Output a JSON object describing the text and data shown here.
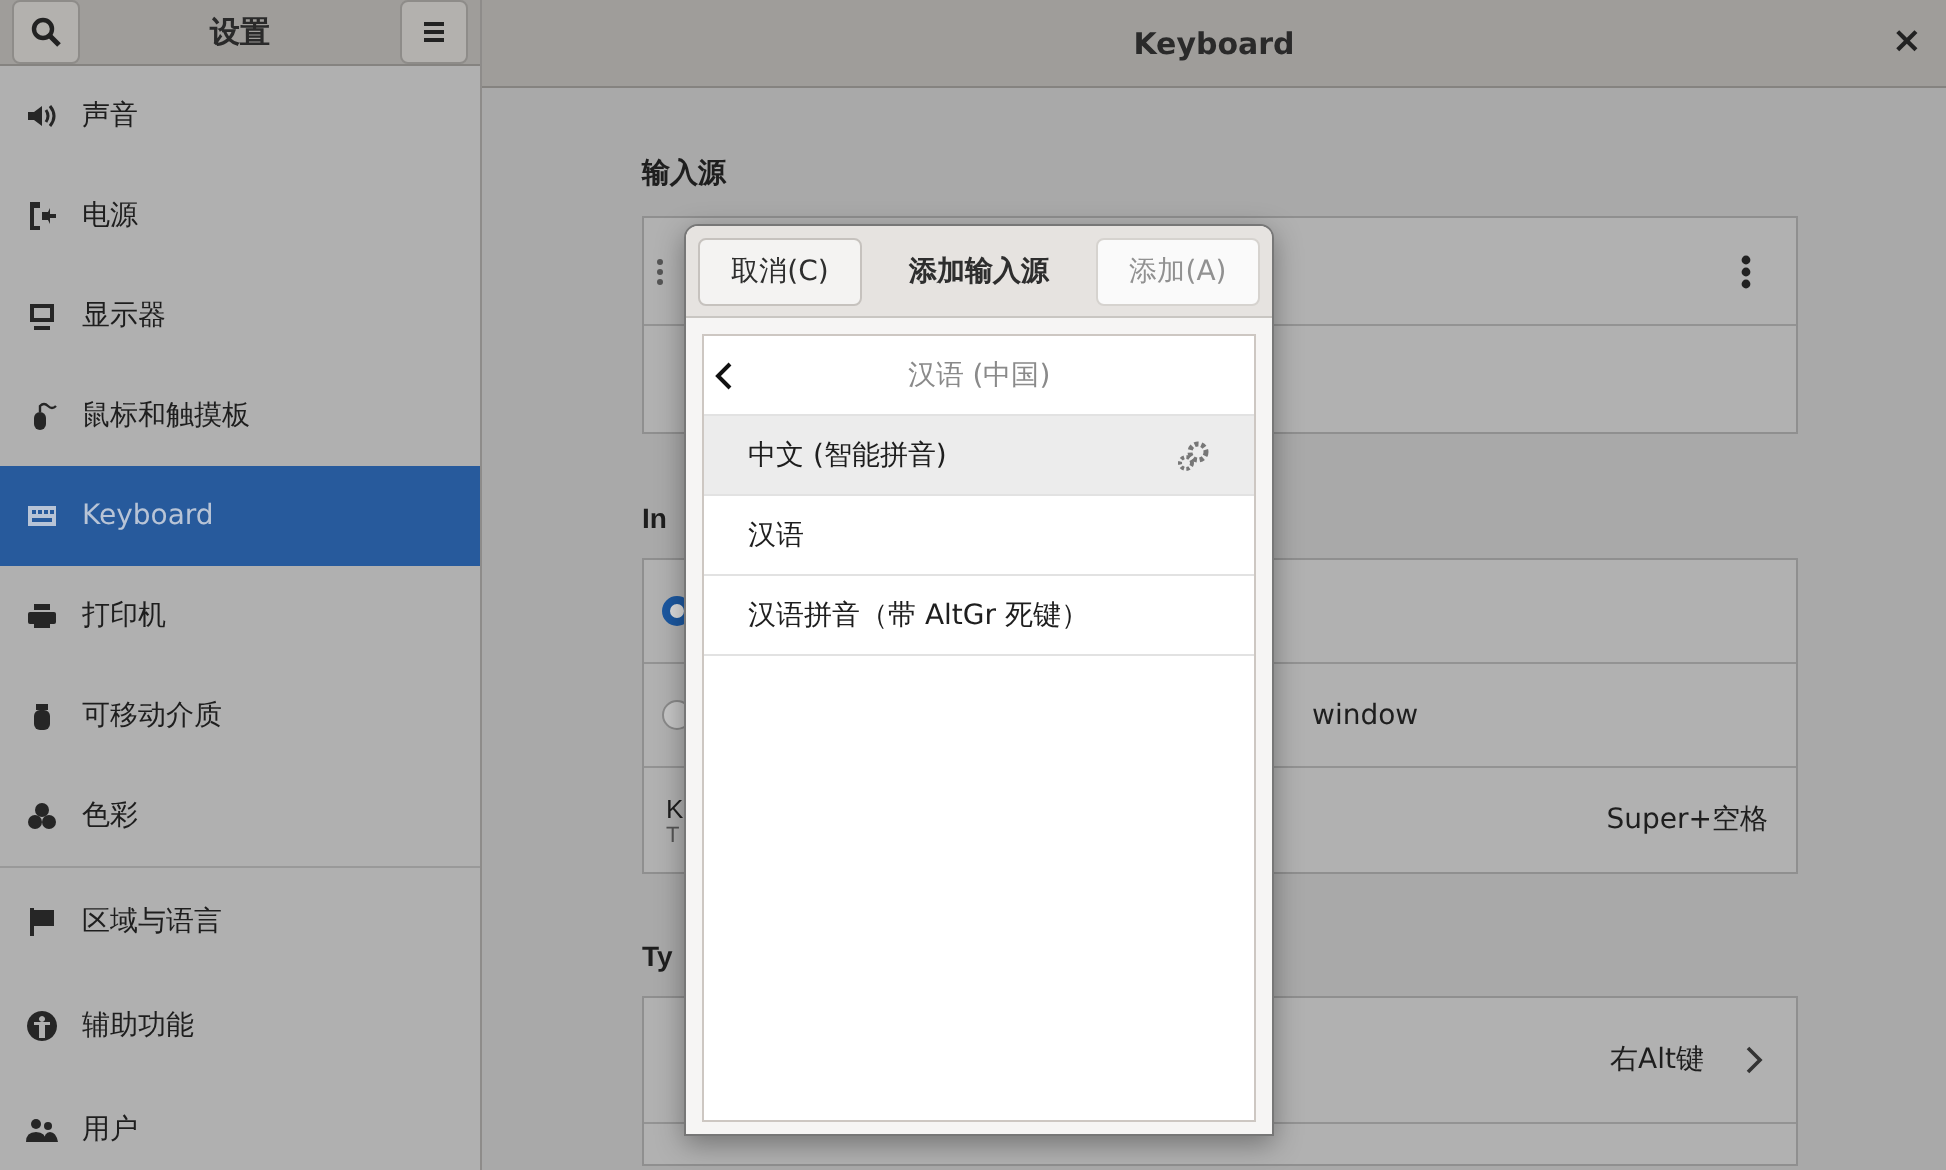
{
  "sidebar": {
    "title": "设置",
    "items": [
      {
        "kind": "speaker",
        "label": "声音",
        "selected": false,
        "separator_after": false
      },
      {
        "kind": "power",
        "label": "电源",
        "selected": false,
        "separator_after": false
      },
      {
        "kind": "display",
        "label": "显示器",
        "selected": false,
        "separator_after": false
      },
      {
        "kind": "mouse",
        "label": "鼠标和触摸板",
        "selected": false,
        "separator_after": false
      },
      {
        "kind": "keyboard",
        "label": "Keyboard",
        "selected": true,
        "separator_after": false
      },
      {
        "kind": "printer",
        "label": "打印机",
        "selected": false,
        "separator_after": false
      },
      {
        "kind": "usb",
        "label": "可移动介质",
        "selected": false,
        "separator_after": false
      },
      {
        "kind": "color",
        "label": "色彩",
        "selected": false,
        "separator_after": true
      },
      {
        "kind": "flag",
        "label": "区域与语言",
        "selected": false,
        "separator_after": false
      },
      {
        "kind": "accessibility",
        "label": "辅助功能",
        "selected": false,
        "separator_after": false
      },
      {
        "kind": "users",
        "label": "用户",
        "selected": false,
        "separator_after": false
      }
    ]
  },
  "window": {
    "title": "Keyboard",
    "close": "×"
  },
  "input_sources": {
    "heading": "输入源"
  },
  "input_switching": {
    "heading": "In",
    "options": [
      {
        "selected": true
      },
      {
        "label": "window",
        "selected": false
      }
    ],
    "shortcut": {
      "title": "K",
      "subtitle": "T",
      "value": "Super+空格"
    }
  },
  "typing": {
    "heading": "Ty",
    "rows": [
      {
        "value": "右Alt键"
      }
    ]
  },
  "dialog": {
    "cancel": "取消(C)",
    "title": "添加输入源",
    "add": {
      "label": "添加(A)",
      "disabled": true
    },
    "back_title": "汉语 (中国)",
    "items": [
      {
        "label": "中文 (智能拼音)",
        "selected": true,
        "has_settings": true
      },
      {
        "label": "汉语",
        "selected": false,
        "has_settings": false
      },
      {
        "label": "汉语拼音（带 AltGr 死键）",
        "selected": false,
        "has_settings": false
      }
    ]
  }
}
